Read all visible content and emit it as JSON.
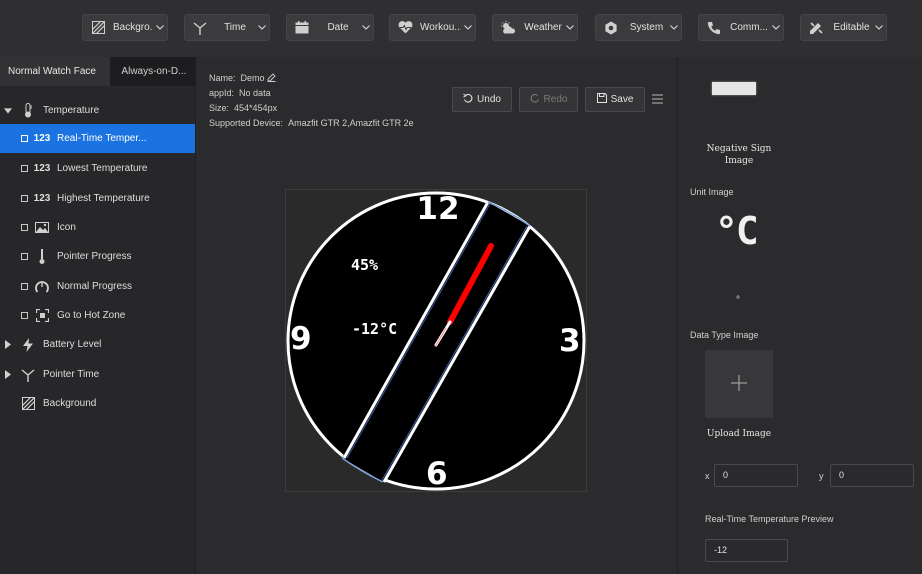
{
  "toolbar": {
    "items": [
      {
        "label": "Backgro...",
        "icon": "background-icon"
      },
      {
        "label": "Time",
        "icon": "pointer-time-icon"
      },
      {
        "label": "Date",
        "icon": "calendar-icon"
      },
      {
        "label": "Workou...",
        "icon": "heart-icon"
      },
      {
        "label": "Weather",
        "icon": "weather-icon"
      },
      {
        "label": "System",
        "icon": "gear-icon"
      },
      {
        "label": "Comm...",
        "icon": "phone-icon"
      },
      {
        "label": "Editable",
        "icon": "edit-tools-icon"
      }
    ]
  },
  "left_panel": {
    "tabs": [
      "Normal Watch Face",
      "Always-on-D..."
    ],
    "tree": {
      "root": "Temperature",
      "children": [
        {
          "label": "Real-Time Temper...",
          "icon": "123"
        },
        {
          "label": "Lowest Temperature",
          "icon": "123"
        },
        {
          "label": "Highest Temperature",
          "icon": "123"
        },
        {
          "label": "Icon",
          "icon": "image-icon"
        },
        {
          "label": "Pointer Progress",
          "icon": "pointer-icon"
        },
        {
          "label": "Normal Progress",
          "icon": "progress-arc-icon"
        },
        {
          "label": "Go to Hot Zone",
          "icon": "hot-zone-icon"
        }
      ],
      "others": [
        "Battery Level",
        "Pointer Time",
        "Background"
      ]
    }
  },
  "info": {
    "name_label": "Name:",
    "name_value": "Demo",
    "appid_label": "appId:",
    "appid_value": "No data",
    "size_label": "Size:",
    "size_value": "454*454px",
    "device_label": "Supported Device:",
    "device_value": "Amazfit GTR 2,Amazfit GTR 2e"
  },
  "actions": {
    "undo": "Undo",
    "redo": "Redo",
    "save": "Save"
  },
  "watch": {
    "numbers": [
      "12",
      "3",
      "6",
      "9"
    ],
    "humidity": "45%",
    "temperature": "-12°C",
    "accent": "#ff0000"
  },
  "right_panel": {
    "negative_sign_label_1": "Negative Sign",
    "negative_sign_label_2": "Image",
    "unit_image_label": "Unit Image",
    "unit_glyph": "°C",
    "degree_glyph": "°",
    "data_type_label": "Data Type Image",
    "upload_label": "Upload Image",
    "x_label": "x",
    "x_value": "0",
    "y_label": "y",
    "y_value": "0",
    "preview_label": "Real-Time Temperature Preview",
    "preview_value": "-12"
  }
}
